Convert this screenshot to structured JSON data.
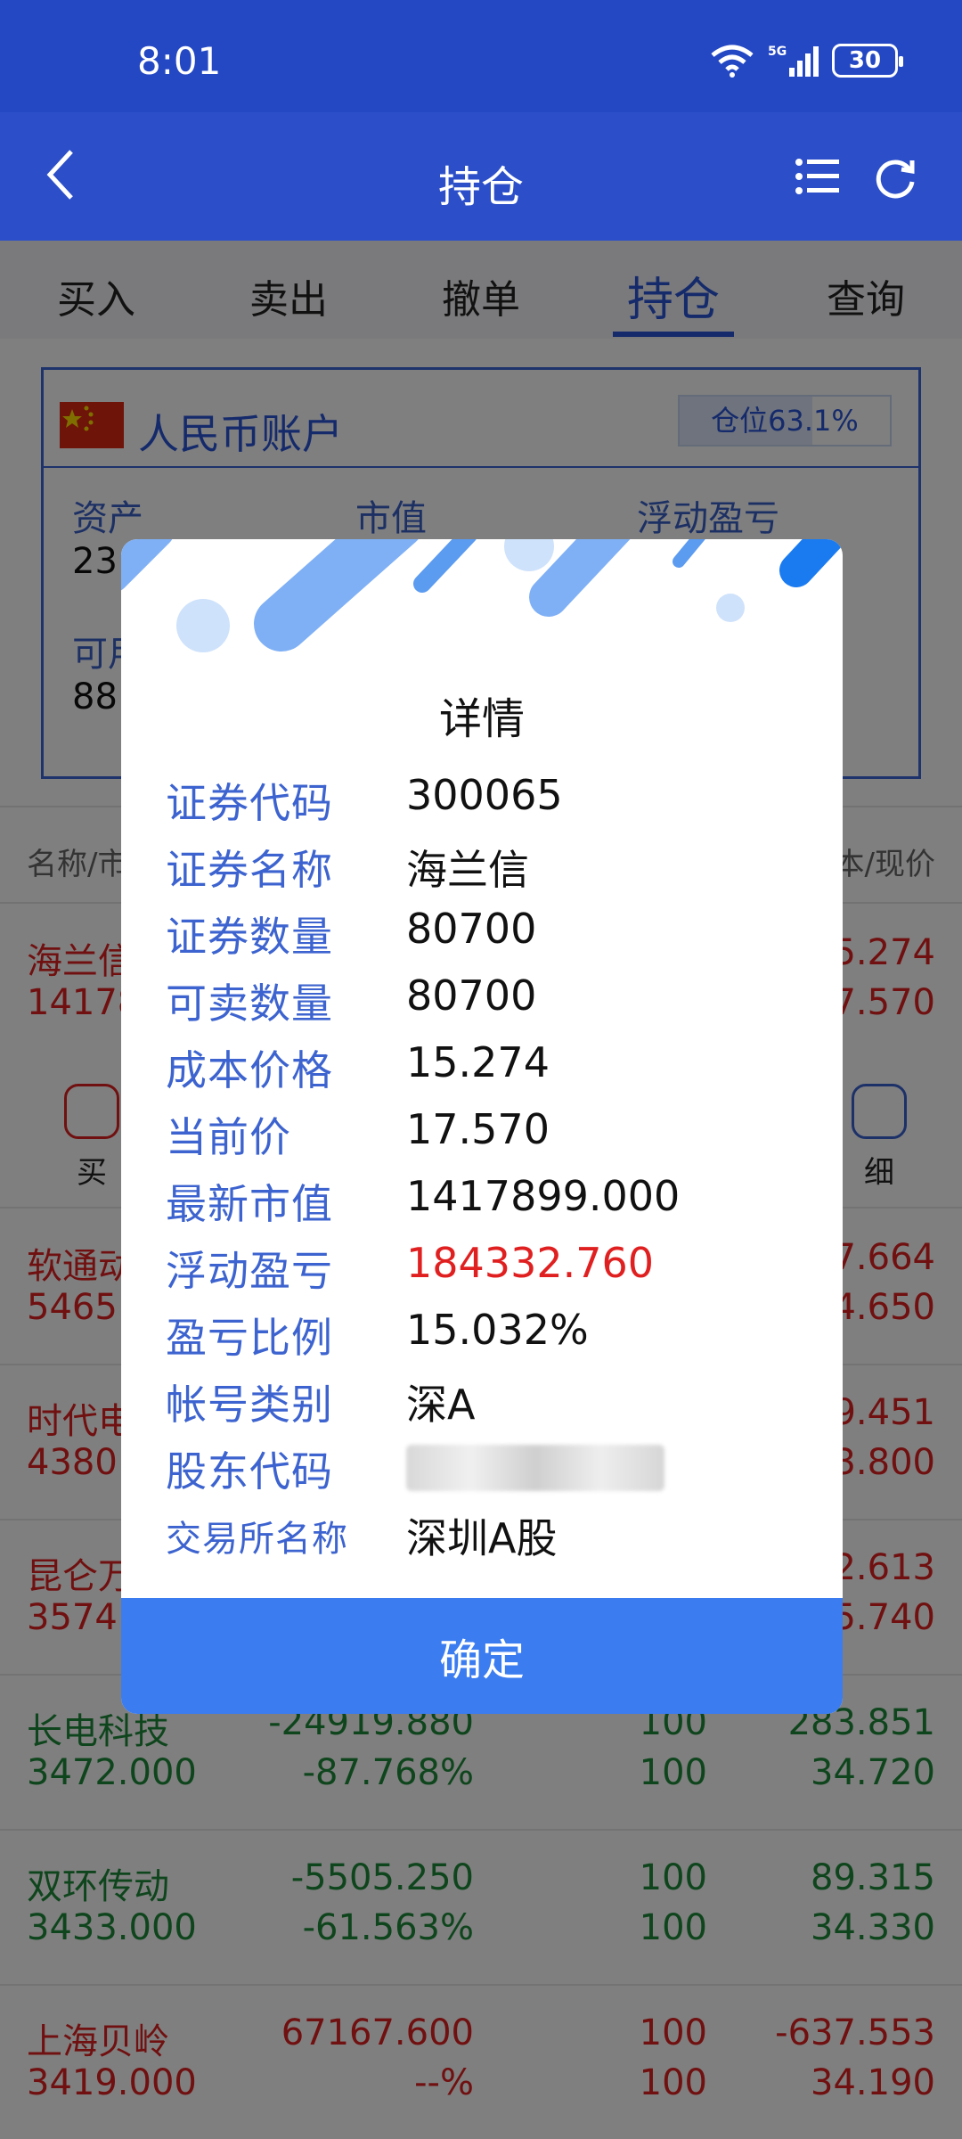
{
  "status_bar": {
    "time": "8:01",
    "network": "5G",
    "battery": "30"
  },
  "nav": {
    "title": "持仓"
  },
  "tabs": [
    "买入",
    "卖出",
    "撤单",
    "持仓",
    "查询"
  ],
  "account": {
    "title": "人民币账户",
    "position_label": "仓位63.1%",
    "position_ratio": 0.631,
    "col_asset": "资产",
    "col_market_value": "市值",
    "col_float_pl": "浮动盈亏",
    "asset_value_partial": "23",
    "available_label_partial": "可用",
    "available_value_partial": "88"
  },
  "list_header": {
    "left": "名称/市",
    "right": "本/现价"
  },
  "rows": [
    {
      "name": "海兰信",
      "value": "14178",
      "r1": "5.274",
      "r2": "7.570",
      "color": "red"
    },
    {
      "name": "软通动",
      "value": "5465.",
      "r1": "7.664",
      "r2": "4.650",
      "color": "red"
    },
    {
      "name": "时代电",
      "value": "4380.",
      "r1": "9.451",
      "r2": "3.800",
      "color": "red"
    },
    {
      "name": "昆仑万",
      "value": "3574.",
      "r1": "2.613",
      "r2": "5.740",
      "color": "red"
    },
    {
      "name": "长电科技",
      "value": "3472.000",
      "pl": "-24919.880",
      "pct": "-87.768%",
      "q1": "100",
      "q2": "100",
      "r1": "283.851",
      "r2": "34.720",
      "color": "green"
    },
    {
      "name": "双环传动",
      "value": "3433.000",
      "pl": "-5505.250",
      "pct": "-61.563%",
      "q1": "100",
      "q2": "100",
      "r1": "89.315",
      "r2": "34.330",
      "color": "green"
    },
    {
      "name": "上海贝岭",
      "value": "3419.000",
      "pl": "67167.600",
      "pct": "--%",
      "q1": "100",
      "q2": "100",
      "r1": "-637.553",
      "r2": "34.190",
      "color": "red"
    }
  ],
  "row_actions": {
    "left_label": "买",
    "right_label": "细"
  },
  "dialog": {
    "title": "详情",
    "fields": [
      {
        "key": "证券代码",
        "value": "300065"
      },
      {
        "key": "证券名称",
        "value": "海兰信"
      },
      {
        "key": "证券数量",
        "value": "80700"
      },
      {
        "key": "可卖数量",
        "value": "80700"
      },
      {
        "key": "成本价格",
        "value": "15.274"
      },
      {
        "key": "当前价",
        "value": "17.570"
      },
      {
        "key": "最新市值",
        "value": "1417899.000"
      },
      {
        "key": "浮动盈亏",
        "value": "184332.760"
      },
      {
        "key": "盈亏比例",
        "value": "15.032%"
      },
      {
        "key": "帐号类别",
        "value": "深A"
      },
      {
        "key": "股东代码",
        "value": ""
      },
      {
        "key": "交易所名称",
        "value": "深圳A股"
      }
    ],
    "confirm_label": "确定"
  },
  "colors": {
    "primary": "#2c4fc9",
    "accent": "#3b7cf0",
    "up": "#e02020",
    "down": "#1f8a3b"
  }
}
